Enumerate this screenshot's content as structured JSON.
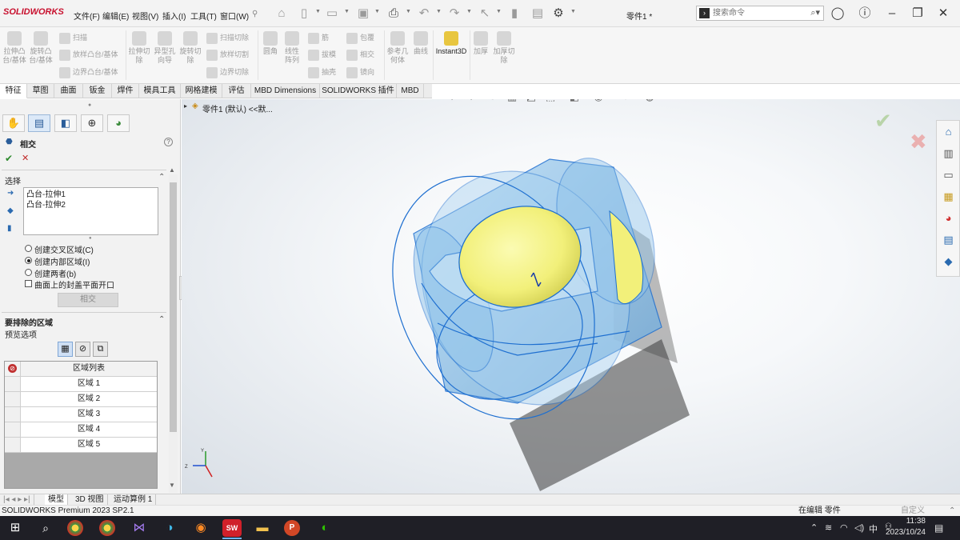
{
  "menubar": {
    "logo": "SOLIDWORKS",
    "items": [
      "文件(F)",
      "编辑(E)",
      "视图(V)",
      "插入(I)",
      "工具(T)",
      "窗口(W)"
    ],
    "doc_title": "零件1 *",
    "search_placeholder": "搜索命令"
  },
  "ribbon": {
    "group1": [
      "拉伸凸台/基体",
      "旋转凸台/基体"
    ],
    "group1_small": [
      "扫描",
      "放样凸台/基体",
      "边界凸台/基体"
    ],
    "group2": [
      "拉伸切除",
      "异型孔向导",
      "旋转切除"
    ],
    "group2_small": [
      "扫描切除",
      "放样切割",
      "边界切除"
    ],
    "group3": [
      "圆角",
      "线性阵列"
    ],
    "group3_small": [
      "筋",
      "拔模",
      "抽壳"
    ],
    "group4_small": [
      "包覆",
      "相交",
      "镜向"
    ],
    "group5": [
      "参考几何体",
      "曲线"
    ],
    "instant3d": "Instant3D",
    "group6": [
      "加厚",
      "加厚切除"
    ]
  },
  "tabs": [
    "特征",
    "草图",
    "曲面",
    "钣金",
    "焊件",
    "模具工具",
    "网格建模",
    "评估",
    "MBD Dimensions",
    "SOLIDWORKS 插件",
    "MBD"
  ],
  "tree": {
    "label": "零件1 (默认) <<默..."
  },
  "property_manager": {
    "title": "相交",
    "help": "?",
    "ok_mark": "✔",
    "cancel_mark": "✕",
    "selection": {
      "header": "选择",
      "items": [
        "凸台-拉伸1",
        "凸台-拉伸2"
      ],
      "options": [
        "创建交叉区域(C)",
        "创建内部区域(I)",
        "创建两者(b)"
      ],
      "selected_index": 1,
      "checkbox_label": "曲面上的封盖平面开口",
      "button_label": "相交"
    },
    "exclude": {
      "header": "要排除的区域",
      "preview_label": "预览选项",
      "table_header": "区域列表",
      "rows": [
        "区域 1",
        "区域 2",
        "区域 3",
        "区域 4",
        "区域 5"
      ]
    }
  },
  "bottom_tabs": [
    "模型",
    "3D 视图",
    "运动算例 1"
  ],
  "status": {
    "left": "SOLIDWORKS Premium 2023 SP2.1",
    "mid": "在编辑 零件",
    "right": "自定义"
  },
  "taskbar": {
    "time": "11:38",
    "date": "2023/10/24",
    "ime": "中"
  },
  "colors": {
    "accent": "#1e6fd0",
    "body_fill": "#8fc3ea",
    "face_yellow": "#f2f07a"
  }
}
